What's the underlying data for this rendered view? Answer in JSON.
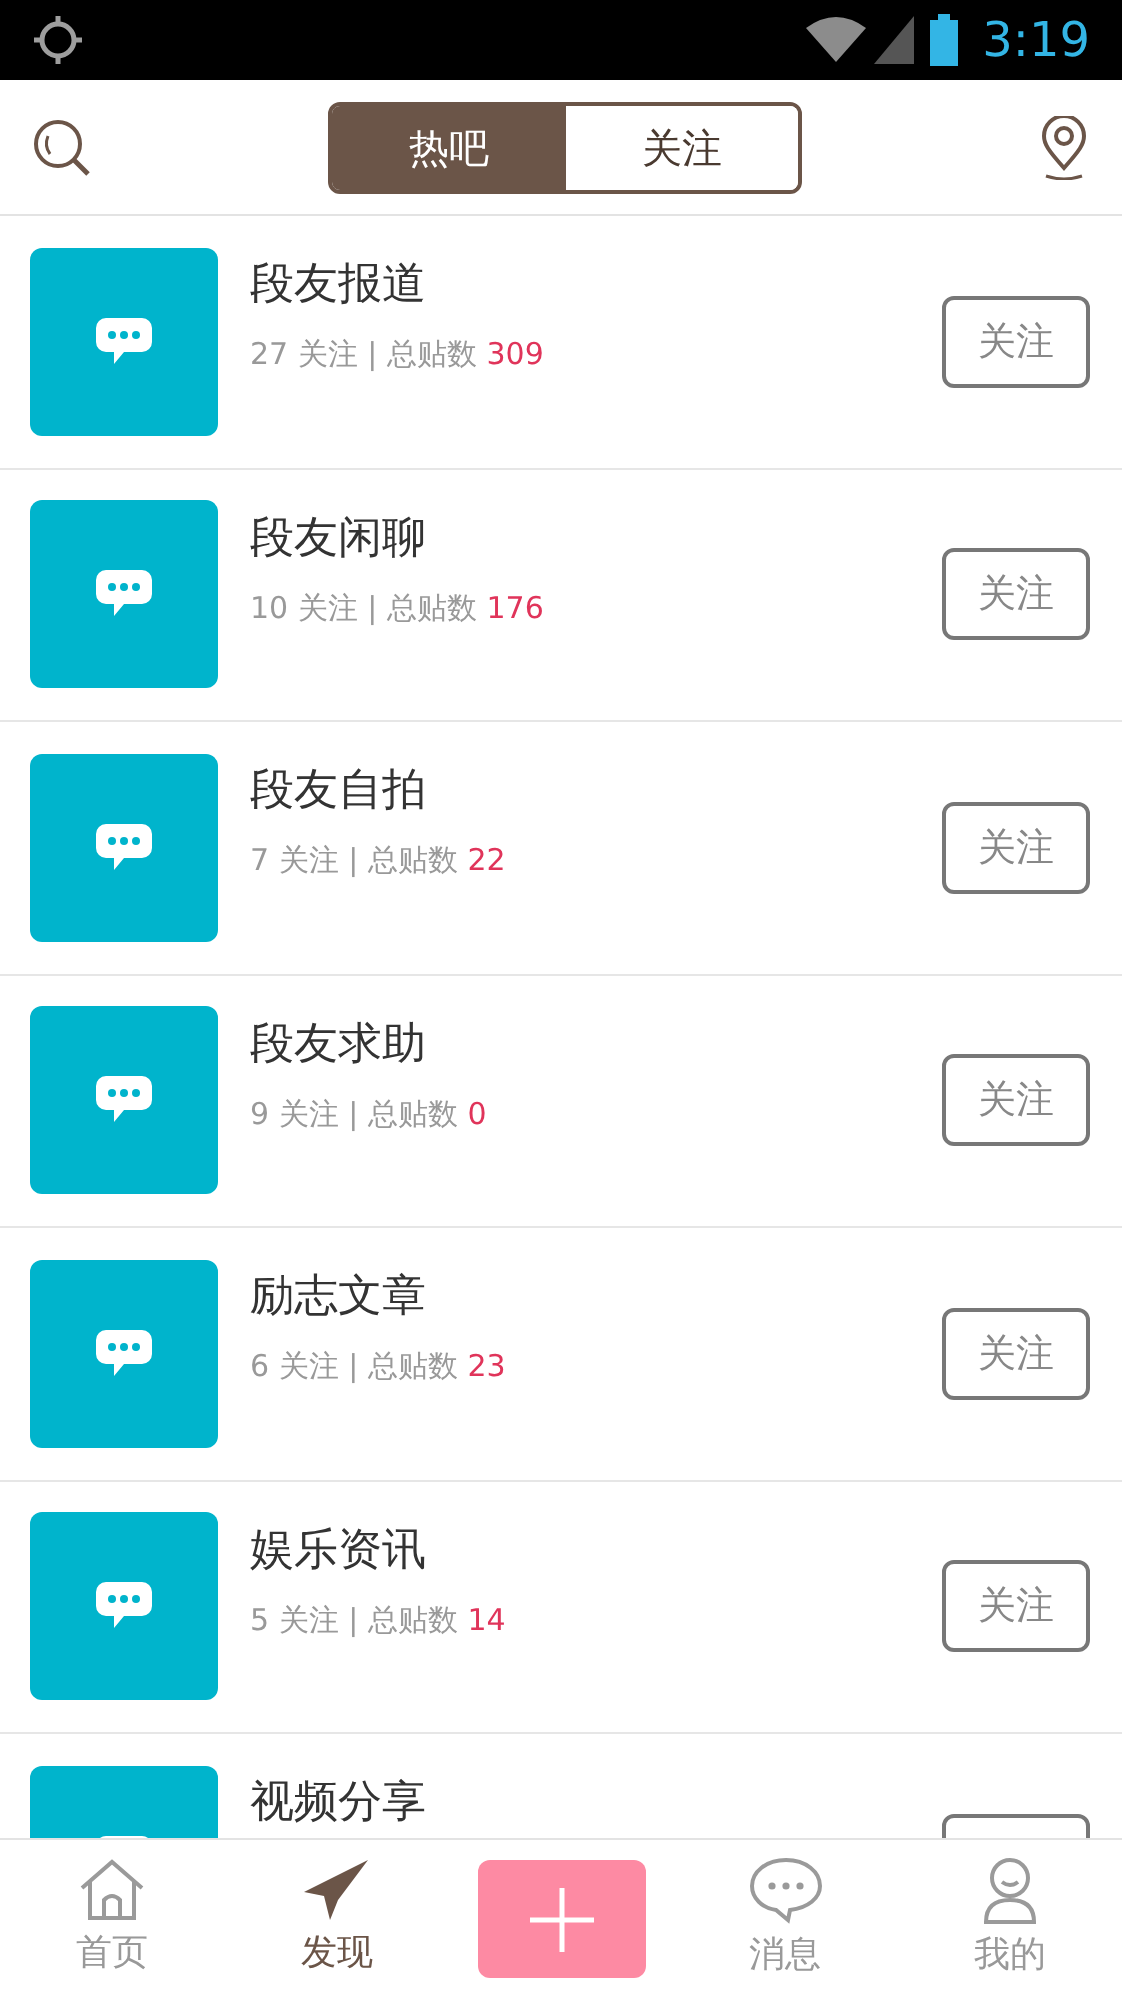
{
  "status_bar": {
    "time": "3:19"
  },
  "tabs": [
    {
      "label": "热吧",
      "selected": true
    },
    {
      "label": "关注",
      "selected": false
    }
  ],
  "forums": [
    {
      "title": "段友报道",
      "stats": "27 关注 | 总贴数",
      "count": "309",
      "button_label": "关注"
    },
    {
      "title": "段友闲聊",
      "stats": "10 关注 | 总贴数",
      "count": "176",
      "button_label": "关注"
    },
    {
      "title": "段友自拍",
      "stats": "7 关注 | 总贴数",
      "count": "22",
      "button_label": "关注"
    },
    {
      "title": "段友求助",
      "stats": "9 关注 | 总贴数",
      "count": "0",
      "button_label": "关注"
    },
    {
      "title": "励志文章",
      "stats": "6 关注 | 总贴数",
      "count": "23",
      "button_label": "关注"
    },
    {
      "title": "娱乐资讯",
      "stats": "5 关注 | 总贴数",
      "count": "14",
      "button_label": "关注"
    },
    {
      "title": "视频分享"
    }
  ],
  "bottom_nav": [
    {
      "kind": "tab",
      "label": "首页",
      "selected": false
    },
    {
      "kind": "tab",
      "label": "发现",
      "selected": true
    },
    {
      "kind": "add"
    },
    {
      "kind": "tab",
      "label": "消息",
      "selected": false
    },
    {
      "kind": "tab",
      "label": "我的",
      "selected": false
    }
  ]
}
